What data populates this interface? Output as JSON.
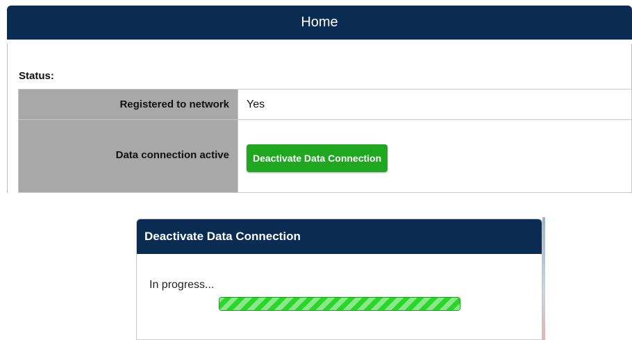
{
  "header": {
    "title": "Home"
  },
  "status": {
    "label": "Status:",
    "rows": [
      {
        "label": "Registered to network",
        "value": "Yes"
      },
      {
        "label": "Data connection active",
        "button_label": "Deactivate Data Connection"
      }
    ]
  },
  "dialog": {
    "title": "Deactivate Data Connection",
    "message": "In progress...",
    "progress_percent": 100
  },
  "colors": {
    "header_bg": "#0a2b52",
    "button_green": "#1fa81f",
    "progress_green": "#2bd62b",
    "label_cell_bg": "#a8a8a8"
  }
}
